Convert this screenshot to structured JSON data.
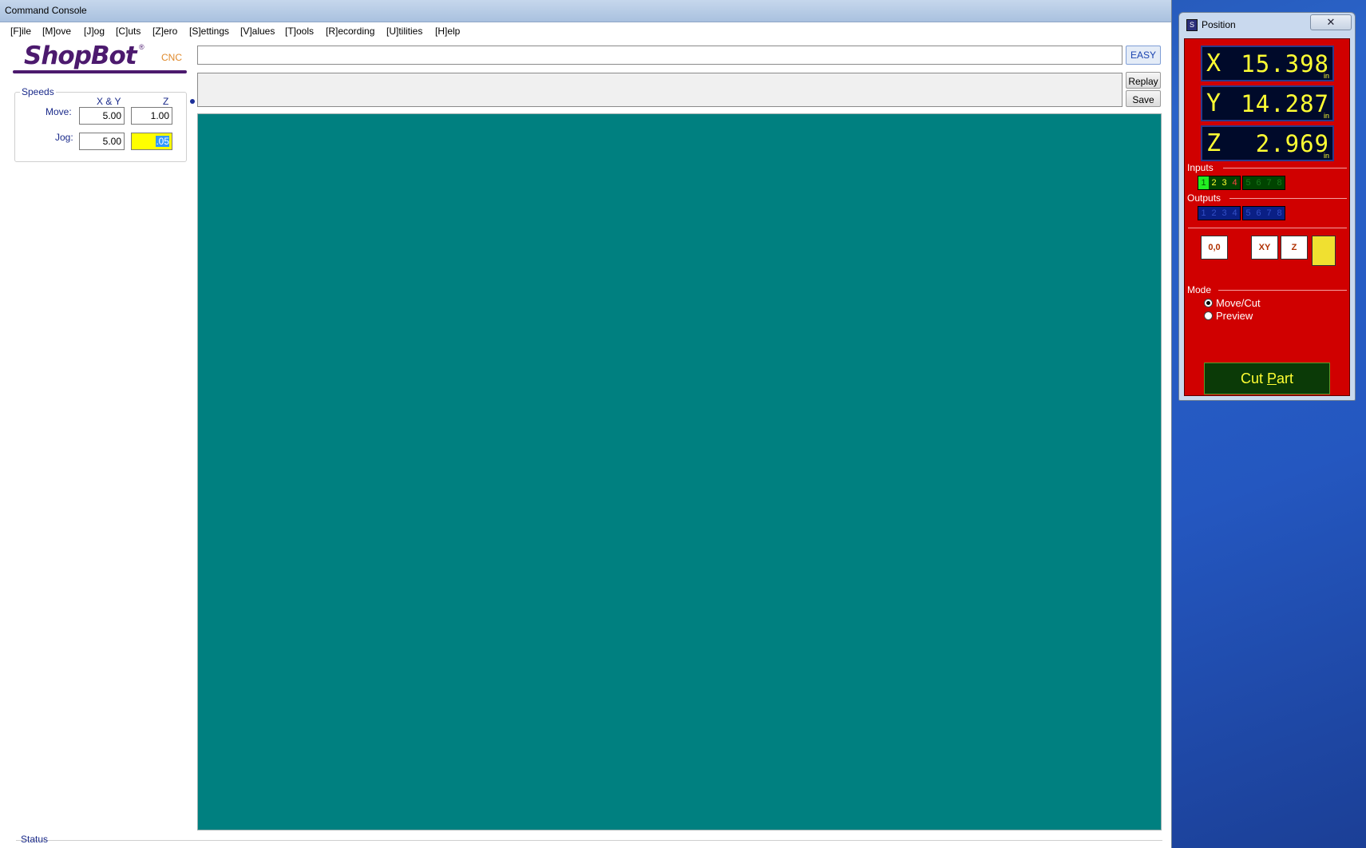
{
  "console": {
    "title": "Command Console",
    "menu": [
      "[F]ile",
      "[M]ove",
      "[J]og",
      "[C]uts",
      "[Z]ero",
      "[S]ettings",
      "[V]alues",
      "[T]ools",
      "[R]ecording",
      "[U]tilities",
      "[H]elp"
    ],
    "logo": {
      "brand": "ShopBot",
      "suffix": "CNC",
      "registered": "®"
    },
    "speeds": {
      "legend": "Speeds",
      "col_xy": "X & Y",
      "col_z": "Z",
      "move_label": "Move:",
      "jog_label": "Jog:",
      "move_xy": "5.00",
      "move_z": "1.00",
      "jog_xy": "5.00",
      "jog_z": ".05"
    },
    "command_input": {
      "value": ""
    },
    "buttons": {
      "easy": "EASY",
      "replay": "Replay",
      "save": "Save"
    },
    "status": {
      "legend": "Status"
    }
  },
  "position": {
    "title": "Position",
    "close": "✕",
    "x": {
      "axis": "X",
      "value": "15.398",
      "unit": "in"
    },
    "y": {
      "axis": "Y",
      "value": "14.287",
      "unit": "in"
    },
    "z": {
      "axis": "Z",
      "value": "2.969",
      "unit": "in"
    },
    "inputs_label": "Inputs",
    "inputs": [
      "1",
      "2",
      "3",
      "4",
      "5",
      "6",
      "7",
      "8"
    ],
    "outputs_label": "Outputs",
    "outputs": [
      "1",
      "2",
      "3",
      "4",
      "5",
      "6",
      "7",
      "8"
    ],
    "tools": {
      "zero_label": "0,0",
      "xy_label": "XY",
      "z_label": "Z"
    },
    "mode_label": "Mode",
    "modes": [
      "Move/Cut",
      "Preview"
    ],
    "selected_mode": "Move/Cut",
    "cut_part": {
      "prefix": "Cut ",
      "mnemonic": "P",
      "rest": "art"
    }
  },
  "colors": {
    "preview_bg": "#008080",
    "position_panel": "#d00000",
    "dro_text": "#ffff33",
    "jog_z_highlight": "#ffff00"
  }
}
